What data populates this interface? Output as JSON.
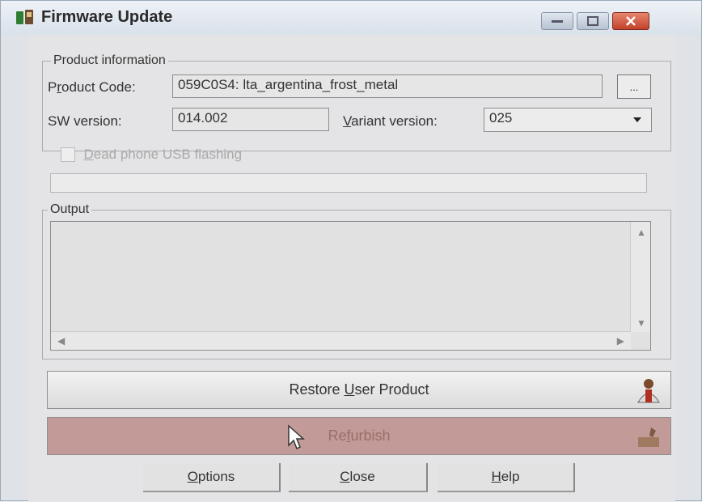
{
  "window": {
    "title": "Firmware Update"
  },
  "product_info": {
    "group_label": "Product information",
    "product_code_label_pre": "P",
    "product_code_label_u": "r",
    "product_code_label_post": "oduct Code:",
    "product_code_value": "059C0S4: lta_argentina_frost_metal",
    "browse_label": "...",
    "sw_version_label": "SW version:",
    "sw_version_value": "014.002",
    "variant_label_u": "V",
    "variant_label_post": "ariant version:",
    "variant_value": "025"
  },
  "dead_phone": {
    "label_u": "D",
    "label_post": "ead phone USB flashing"
  },
  "output": {
    "group_label": "Output"
  },
  "buttons": {
    "restore_pre": "Restore ",
    "restore_u": "U",
    "restore_post": "ser Product",
    "refurbish_pre": "Re",
    "refurbish_u": "f",
    "refurbish_post": "urbish",
    "options_u": "O",
    "options_post": "ptions",
    "close_u": "C",
    "close_post": "lose",
    "help_u": "H",
    "help_post": "elp"
  }
}
